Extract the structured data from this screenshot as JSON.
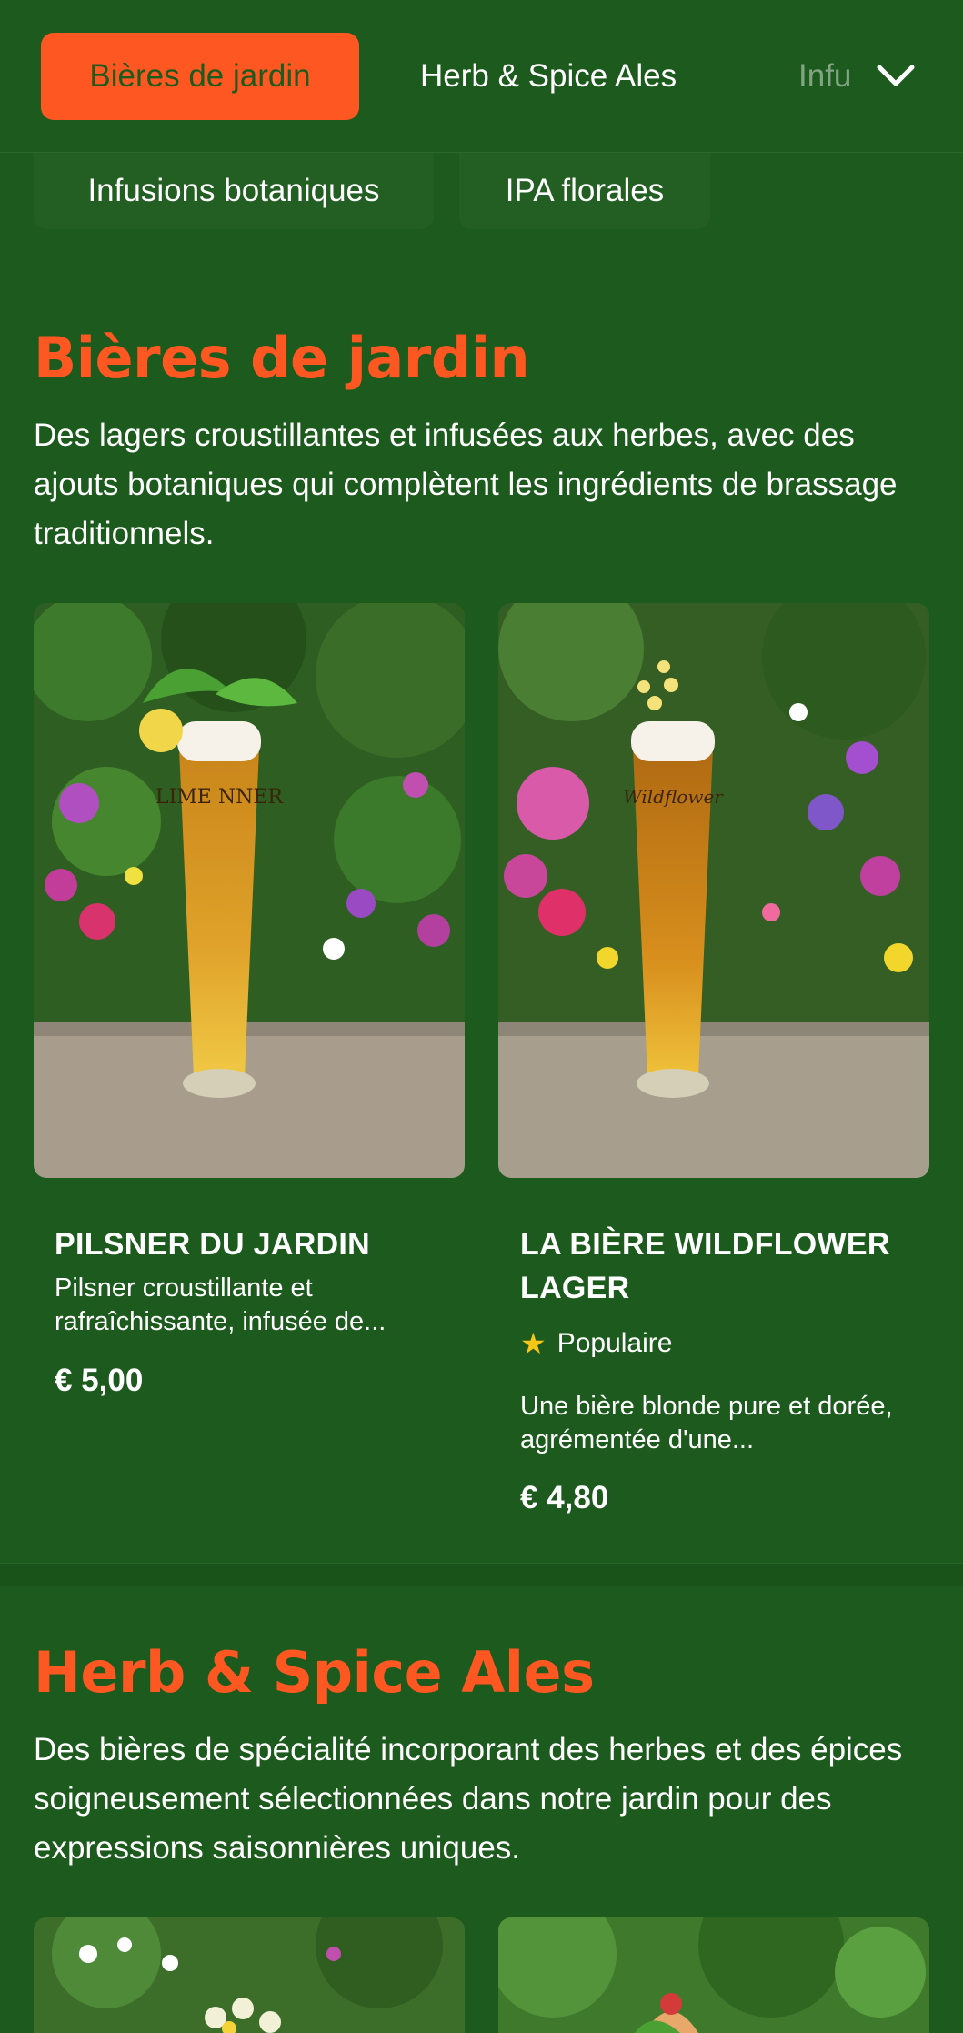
{
  "nav": {
    "tabs": [
      {
        "label": "Bières de jardin",
        "active": true
      },
      {
        "label": "Herb & Spice Ales",
        "active": false
      },
      {
        "label": "Infu",
        "active": false
      }
    ],
    "more_icon": "chevron-down-icon"
  },
  "chips": [
    "Infusions botaniques",
    "IPA florales"
  ],
  "sections": [
    {
      "title": "Bières de jardin",
      "description": "Des lagers croustillantes et infusées aux herbes, avec des ajouts botaniques qui complètent les ingrédients de brassage traditionnels.",
      "products": [
        {
          "name": "PILSNER DU JARDIN",
          "description": "Pilsner croustillante et rafraîchissante, infusée de...",
          "price": "€ 5,00",
          "glass_text": "LIME NNER"
        },
        {
          "name": "LA BIÈRE WILDFLOWER LAGER",
          "badge": "Populaire",
          "description": "Une bière blonde pure et dorée, agrémentée d'une...",
          "price": "€ 4,80",
          "glass_text": "Wildflower"
        }
      ]
    },
    {
      "title": "Herb & Spice Ales",
      "description": "Des bières de spécialité incorporant des herbes et des épices soigneusement sélectionnées dans notre jardin pour des expressions saisonnières uniques."
    }
  ],
  "colors": {
    "background": "#1d5a1d",
    "accent": "#ff5722",
    "star": "#f5c518"
  }
}
